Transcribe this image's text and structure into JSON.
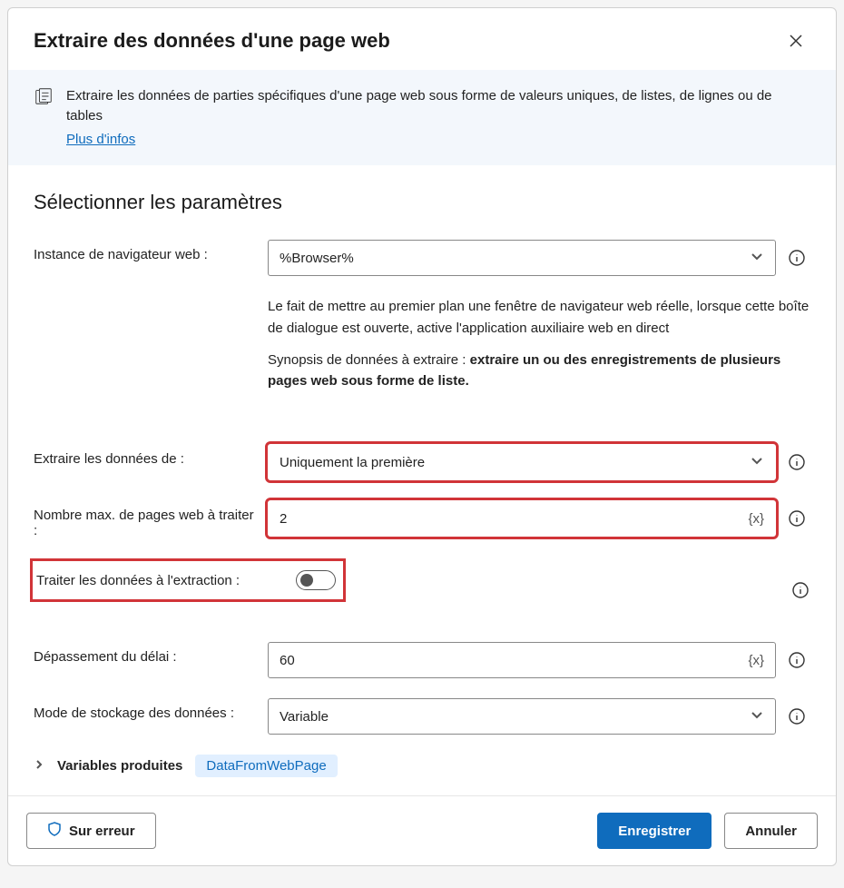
{
  "dialog": {
    "title": "Extraire des données d'une page web"
  },
  "banner": {
    "text": "Extraire les données de parties spécifiques d'une page web sous forme de valeurs uniques, de listes, de lignes ou de tables",
    "link": "Plus d'infos"
  },
  "section": {
    "title": "Sélectionner les paramètres"
  },
  "fields": {
    "browser_instance": {
      "label": "Instance de navigateur web :",
      "value": "%Browser%"
    },
    "description": {
      "line1": "Le fait de mettre au premier plan une fenêtre de navigateur web réelle, lorsque cette boîte de dialogue est ouverte, active l'application auxiliaire web en direct",
      "synopsis_prefix": "Synopsis de données à extraire : ",
      "synopsis_bold": "extraire un ou des enregistrements de plusieurs pages web sous forme de liste."
    },
    "extract_from": {
      "label": "Extraire les données de :",
      "value": "Uniquement la première"
    },
    "max_pages": {
      "label": "Nombre max. de pages web à traiter :",
      "value": "2",
      "token": "{x}"
    },
    "process_on_extract": {
      "label": "Traiter les données à l'extraction :"
    },
    "timeout": {
      "label": "Dépassement du délai :",
      "value": "60",
      "token": "{x}"
    },
    "storage_mode": {
      "label": "Mode de stockage des données :",
      "value": "Variable"
    }
  },
  "variables": {
    "label": "Variables produites",
    "chip": "DataFromWebPage"
  },
  "footer": {
    "on_error": "Sur erreur",
    "save": "Enregistrer",
    "cancel": "Annuler"
  }
}
